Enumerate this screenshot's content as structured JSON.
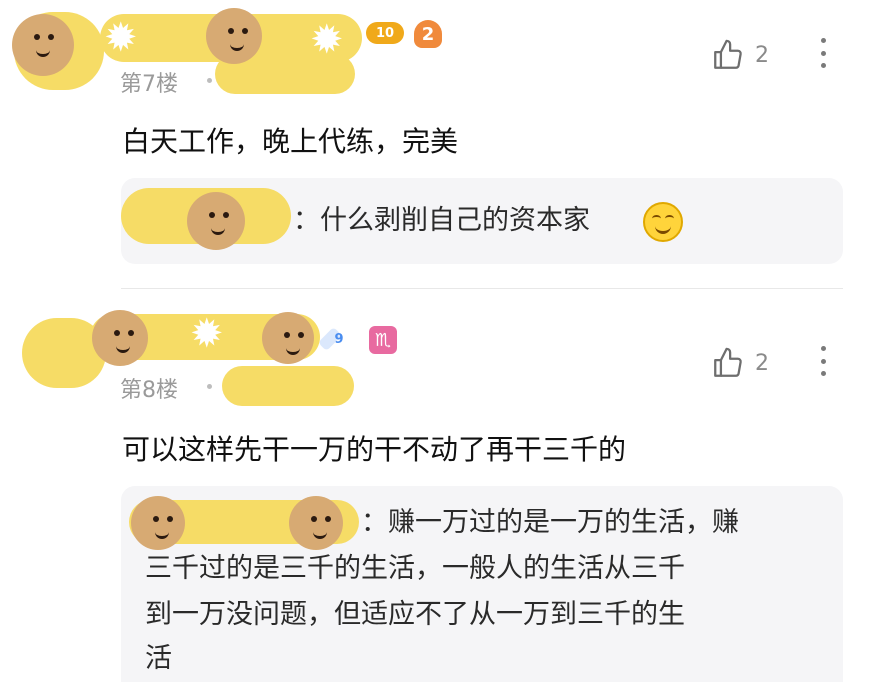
{
  "comments": [
    {
      "floor_label": "第7楼",
      "level": "10",
      "level_color": "#f0a91a",
      "second_badge_glyph": "2",
      "second_badge_color": "#f08a3c",
      "like_count": "2",
      "text": "白天工作，晚上代练，完美",
      "reply": {
        "separator": "：",
        "text": "什么剥削自己的资本家",
        "emoji": "grinning-emoji"
      }
    },
    {
      "floor_label": "第8楼",
      "level": "9",
      "level_color": "#4a8df0",
      "second_badge_glyph": "♏",
      "second_badge_color": "#e86aa0",
      "like_count": "2",
      "text": "可以这样先干一万的干不动了再干三千的",
      "reply": {
        "separator": "：",
        "lines": [
          "赚一万过的是一万的生活，赚",
          "三千过的是三千的生活，一般人的生活从三千",
          "到一万没问题，但适应不了从一万到三千的生",
          "活"
        ]
      }
    }
  ],
  "icons": {
    "like": "thumbs-up-icon",
    "more": "more-vertical-icon"
  }
}
